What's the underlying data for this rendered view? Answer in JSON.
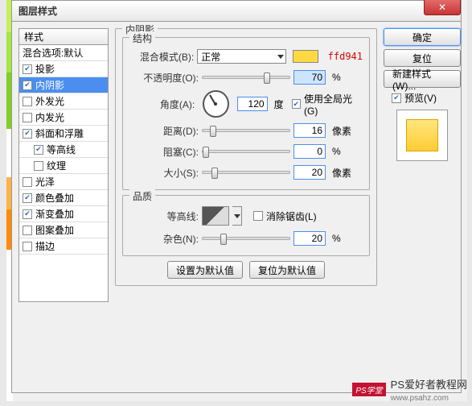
{
  "window": {
    "title": "图层样式"
  },
  "close": {
    "glyph": "✕"
  },
  "sidebar": {
    "header": "样式",
    "blend": "混合选项:默认",
    "items": [
      {
        "label": "投影",
        "checked": true
      },
      {
        "label": "内阴影",
        "checked": true,
        "selected": true
      },
      {
        "label": "外发光",
        "checked": false
      },
      {
        "label": "内发光",
        "checked": false
      },
      {
        "label": "斜面和浮雕",
        "checked": true
      },
      {
        "label": "等高线",
        "checked": true,
        "sub": true
      },
      {
        "label": "纹理",
        "checked": false,
        "sub": true
      },
      {
        "label": "光泽",
        "checked": false
      },
      {
        "label": "颜色叠加",
        "checked": true
      },
      {
        "label": "渐变叠加",
        "checked": true
      },
      {
        "label": "图案叠加",
        "checked": false
      },
      {
        "label": "描边",
        "checked": false
      }
    ]
  },
  "panel": {
    "title": "内阴影",
    "structure": {
      "legend": "结构",
      "blend_label": "混合模式(B):",
      "blend_value": "正常",
      "color_hex": "ffd941",
      "opacity_label": "不透明度(O):",
      "opacity_value": "70",
      "opacity_unit": "%",
      "angle_label": "角度(A):",
      "angle_value": "120",
      "angle_unit": "度",
      "global_label": "使用全局光(G)",
      "distance_label": "距离(D):",
      "distance_value": "16",
      "distance_unit": "像素",
      "choke_label": "阻塞(C):",
      "choke_value": "0",
      "choke_unit": "%",
      "size_label": "大小(S):",
      "size_value": "20",
      "size_unit": "像素"
    },
    "quality": {
      "legend": "品质",
      "contour_label": "等高线:",
      "anti_label": "消除锯齿(L)",
      "noise_label": "杂色(N):",
      "noise_value": "20",
      "noise_unit": "%"
    },
    "defaults": {
      "set": "设置为默认值",
      "reset": "复位为默认值"
    }
  },
  "right": {
    "ok": "确定",
    "cancel": "复位",
    "newstyle": "新建样式(W)...",
    "preview_label": "预览(V)"
  },
  "watermark": {
    "badge": "PS学堂",
    "text": "PS爱好者教程网",
    "url": "www.psahz.com"
  }
}
